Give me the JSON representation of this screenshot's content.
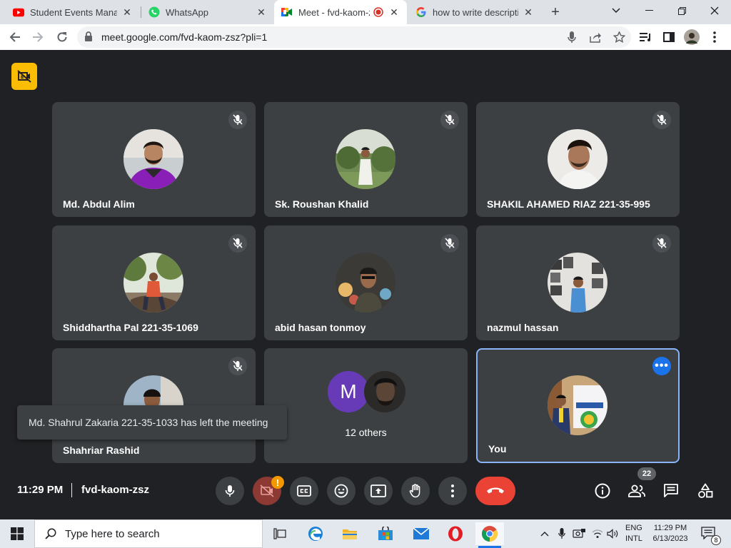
{
  "browser": {
    "tabs": [
      {
        "label": "Student Events Manage"
      },
      {
        "label": "WhatsApp"
      },
      {
        "label": "Meet - fvd-kaom-z"
      },
      {
        "label": "how to write descriptio"
      }
    ],
    "url": "meet.google.com/fvd-kaom-zsz?pli=1"
  },
  "meet": {
    "participants": [
      {
        "name": "Md. Abdul Alim"
      },
      {
        "name": "Sk. Roushan Khalid"
      },
      {
        "name": "SHAKIL AHAMED RIAZ 221-35-995"
      },
      {
        "name": "Shiddhartha Pal 221-35-1069"
      },
      {
        "name": "abid hasan tonmoy"
      },
      {
        "name": "nazmul hassan"
      },
      {
        "name": "Shahriar Rashid"
      }
    ],
    "others": {
      "initial": "M",
      "label": "12 others"
    },
    "self": {
      "name": "You"
    },
    "toast": "Md. Shahrul Zakaria 221-35-1033 has left the meeting",
    "time": "11:29 PM",
    "meeting_code": "fvd-kaom-zsz",
    "camera_warning": "!",
    "people_count": "22"
  },
  "taskbar": {
    "search_placeholder": "Type here to search",
    "lang_line1": "ENG",
    "lang_line2": "INTL",
    "time": "11:29 PM",
    "date": "6/13/2023",
    "notification_count": "8"
  },
  "colors": {
    "meet_bg": "#202124",
    "tile_bg": "#3c4043",
    "end_call_red": "#ea4335",
    "host_badge_yellow": "#fbbc04",
    "self_border_blue": "#8ab4f8"
  }
}
